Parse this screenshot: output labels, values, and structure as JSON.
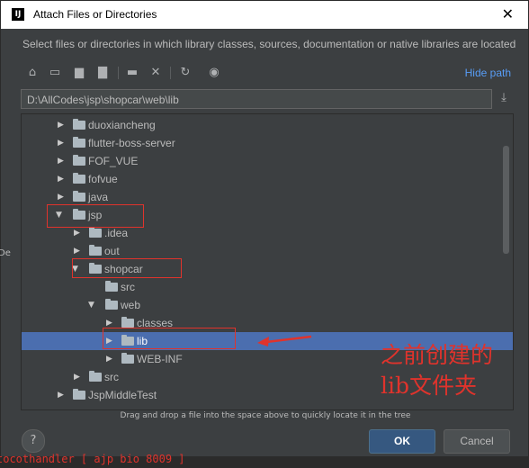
{
  "window": {
    "title": "Attach Files or Directories",
    "app_logo": "IJ"
  },
  "description": "Select files or directories in which library classes, sources, documentation or native libraries are located",
  "toolbar": {
    "icons": [
      "home-icon",
      "desktop-icon",
      "project-icon",
      "module-icon",
      "new-folder-icon",
      "delete-icon",
      "refresh-icon",
      "show-hidden-icon"
    ],
    "hide_path_label": "Hide path"
  },
  "path": {
    "value": "D:\\AllCodes\\jsp\\shopcar\\web\\lib"
  },
  "tree": [
    {
      "label": "duoxiancheng",
      "depth": 0,
      "expanded": false
    },
    {
      "label": "flutter-boss-server",
      "depth": 0,
      "expanded": false
    },
    {
      "label": "FOF_VUE",
      "depth": 0,
      "expanded": false
    },
    {
      "label": "fofvue",
      "depth": 0,
      "expanded": false
    },
    {
      "label": "java",
      "depth": 0,
      "expanded": false
    },
    {
      "label": "jsp",
      "depth": 0,
      "expanded": true
    },
    {
      "label": ".idea",
      "depth": 1,
      "expanded": false
    },
    {
      "label": "out",
      "depth": 1,
      "expanded": false
    },
    {
      "label": "shopcar",
      "depth": 1,
      "expanded": true
    },
    {
      "label": "src",
      "depth": 2,
      "expanded": null
    },
    {
      "label": "web",
      "depth": 2,
      "expanded": true
    },
    {
      "label": "classes",
      "depth": 3,
      "expanded": false
    },
    {
      "label": "lib",
      "depth": 3,
      "expanded": false,
      "selected": true
    },
    {
      "label": "WEB-INF",
      "depth": 3,
      "expanded": false
    },
    {
      "label": "src",
      "depth": 1,
      "expanded": false
    },
    {
      "label": "JspMiddleTest",
      "depth": 0,
      "expanded": false
    }
  ],
  "hint": "Drag and drop a file into the space above to quickly locate it in the tree",
  "buttons": {
    "help": "?",
    "ok": "OK",
    "cancel": "Cancel"
  },
  "annotation": {
    "line1": "之前创建的",
    "line2": "lib文件夹"
  },
  "background": {
    "bottom_text": "tocothandler [ ajp bio 8009 ]",
    "left_text": "De"
  },
  "colors": {
    "selection": "#4b6eaf",
    "annotation": "#e0332c",
    "link": "#589df6",
    "ok_button": "#365880"
  }
}
